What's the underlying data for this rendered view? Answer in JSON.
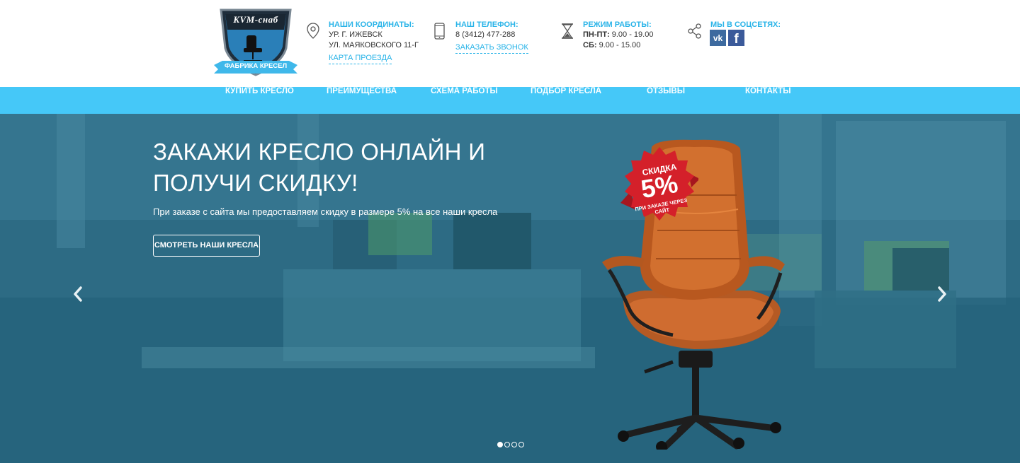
{
  "logo": {
    "brand_text": "KVM-снаб",
    "ribbon_text": "ФАБРИКА КРЕСЕЛ"
  },
  "contacts": {
    "address": {
      "icon": "location-pin-icon",
      "title": "Наши координаты:",
      "line1": "УР. Г. ИЖЕВСК",
      "line2": "УЛ. МАЯКОВСКОГО 11-Г",
      "link": "КАРТА ПРОЕЗДА"
    },
    "phone": {
      "icon": "phone-icon",
      "title": "Наш телефон:",
      "number": "8 (3412) 477-288",
      "link": "ЗАКАЗАТЬ ЗВОНОК"
    },
    "hours": {
      "icon": "hourglass-icon",
      "title": "Режим работы:",
      "weekdays_label": "ПН-ПТ:",
      "weekdays_value": "9.00 - 19.00",
      "saturday_label": "СБ:",
      "saturday_value": "9.00 - 15.00"
    },
    "social": {
      "icon": "share-icon",
      "title": "Мы в соцсетях:",
      "networks": [
        {
          "name": "vk",
          "label": "vk",
          "icon": "vk-icon",
          "color": "#3d6a9f"
        },
        {
          "name": "facebook",
          "label": "f",
          "icon": "facebook-icon",
          "color": "#3b5a9a"
        }
      ]
    }
  },
  "nav": {
    "items": [
      {
        "label": "КУПИТЬ КРЕСЛО"
      },
      {
        "label": "ПРЕИМУЩЕСТВА"
      },
      {
        "label": "СХЕМА РАБОТЫ"
      },
      {
        "label": "ПОДБОР КРЕСЛА"
      },
      {
        "label": "ОТЗЫВЫ"
      },
      {
        "label": "КОНТАКТЫ"
      }
    ]
  },
  "hero": {
    "title": "Закажи кресло онлайн и получи скидку!",
    "subtitle": "При заказе с сайта мы предоставляем скидку в размере 5% на все наши кресла",
    "button": "СМОТРЕТЬ НАШИ КРЕСЛА",
    "badge": {
      "line1": "СКИДКА",
      "value": "5%",
      "line3": "ПРИ ЗАКАЗЕ ЧЕРЕЗ САЙТ"
    },
    "slides_total": 4,
    "active_slide": 1
  },
  "colors": {
    "accent": "#45c8f8",
    "accent_text": "#2ab4e8",
    "hero_overlay": "#2f6b84",
    "chair": "#c8642a",
    "badge": "#d4202a"
  }
}
